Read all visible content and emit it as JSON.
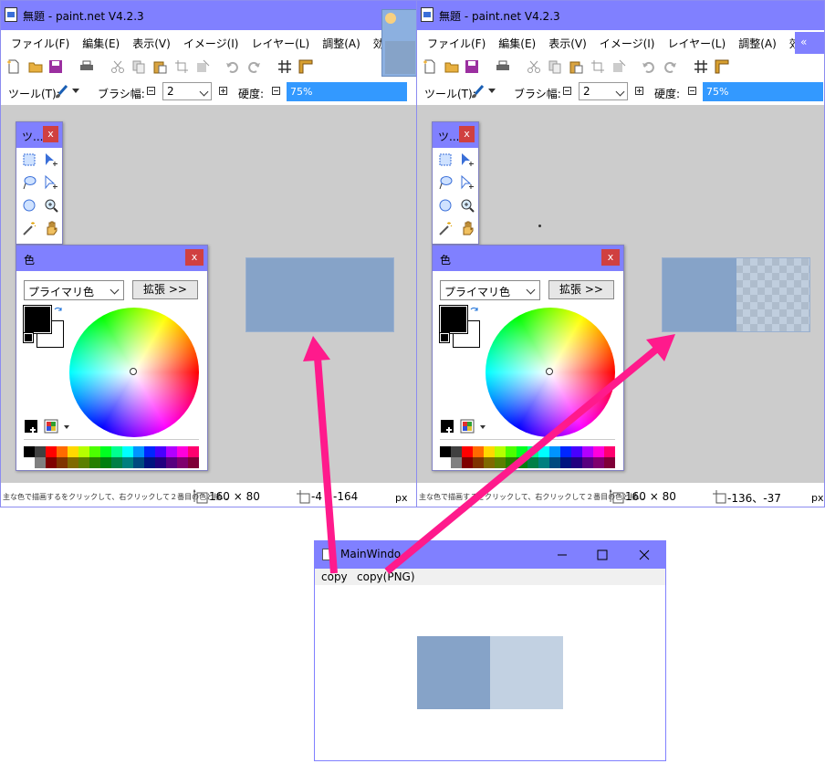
{
  "left_window": {
    "title": "無題 - paint.net V4.2.3",
    "menu": [
      "ファイル(F)",
      "編集(E)",
      "表示(V)",
      "イメージ(I)",
      "レイヤー(L)",
      "調整(A)",
      "効果(C)"
    ],
    "options": {
      "tool_label": "ツール(T):",
      "brush_label": "ブラシ幅:",
      "brush_value": "2",
      "hardness_label": "硬度:",
      "hardness_value": "75%"
    },
    "status": {
      "hint": "主な色で描画するをクリックして、右クリックして２番目の色と描...",
      "image_size": "160 × 80",
      "cursor": "-4",
      "cursor2": "-164",
      "unit": "px"
    }
  },
  "right_window": {
    "title": "無題 - paint.net V4.2.3",
    "menu": [
      "ファイル(F)",
      "編集(E)",
      "表示(V)",
      "イメージ(I)",
      "レイヤー(L)",
      "調整(A)",
      "効果(C)"
    ],
    "overflow": "«",
    "options": {
      "tool_label": "ツール(T):",
      "brush_label": "ブラシ幅:",
      "brush_value": "2",
      "hardness_label": "硬度:",
      "hardness_value": "75%"
    },
    "status": {
      "hint": "主な色で描画するをクリックして、右クリックして２番目の色と描...",
      "image_size": "160 × 80",
      "cursor": "-136、-37",
      "unit": "px"
    }
  },
  "tools_panel": {
    "title": "ツ...",
    "close": "x"
  },
  "colors_panel": {
    "title": "色",
    "close": "x",
    "primary_option": "プライマリ色",
    "expand_button": "拡張 >>"
  },
  "main_window": {
    "title": "MainWindo",
    "menu_copy": "copy",
    "menu_copy_png": "copy(PNG)"
  },
  "colors": {
    "titlebar": "#8080ff",
    "canvas_bg": "#cccccc",
    "image_fill": "#86a3c8",
    "image_fill_light": "#c2d1e2",
    "arrow": "#ff1a8c"
  }
}
